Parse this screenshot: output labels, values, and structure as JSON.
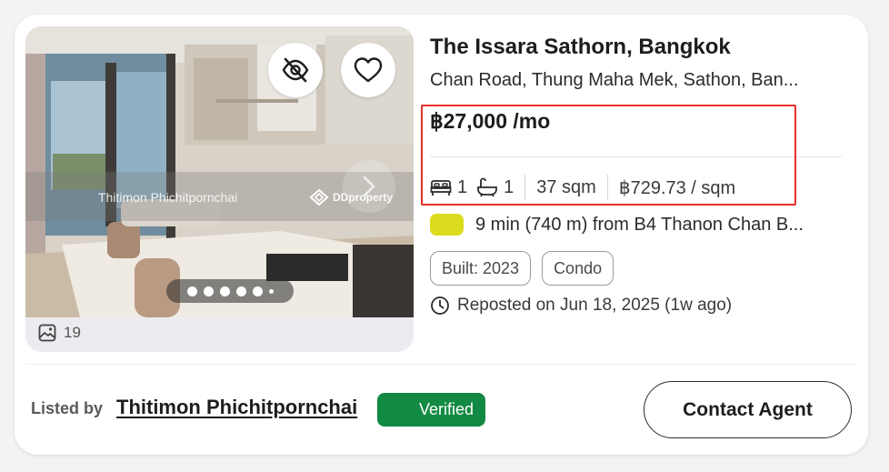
{
  "listing": {
    "title": "The Issara Sathorn, Bangkok",
    "address": "Chan Road, Thung Maha Mek, Sathon, Ban...",
    "price": "฿27,000 /mo",
    "bedrooms": "1",
    "bathrooms": "1",
    "area": "37 sqm",
    "price_per_sqm": "฿729.73 / sqm",
    "transit": "9 min (740 m) from B4 Thanon Chan B...",
    "transit_line_color": "#dcdc1e",
    "tags": [
      "Built: 2023",
      "Condo"
    ],
    "reposted": "Reposted on Jun 18, 2025 (1w ago)"
  },
  "media": {
    "photo_count": "19",
    "watermark_name": "Thitimon Phichitpornchai",
    "watermark_brand": "DDproperty",
    "carousel_dots": 6,
    "active_dot": 1
  },
  "footer": {
    "listed_by_label": "Listed by",
    "agent_name": "Thitimon Phichitpornchai",
    "verified_label": "Verified",
    "contact_label": "Contact Agent"
  },
  "colors": {
    "verified": "#128a43",
    "highlight": "#e8302c"
  },
  "icons": [
    "hide-icon",
    "heart-icon",
    "chevron-right-icon",
    "gallery-icon",
    "bed-icon",
    "bath-icon",
    "clock-icon",
    "ddproperty-logo-icon"
  ]
}
